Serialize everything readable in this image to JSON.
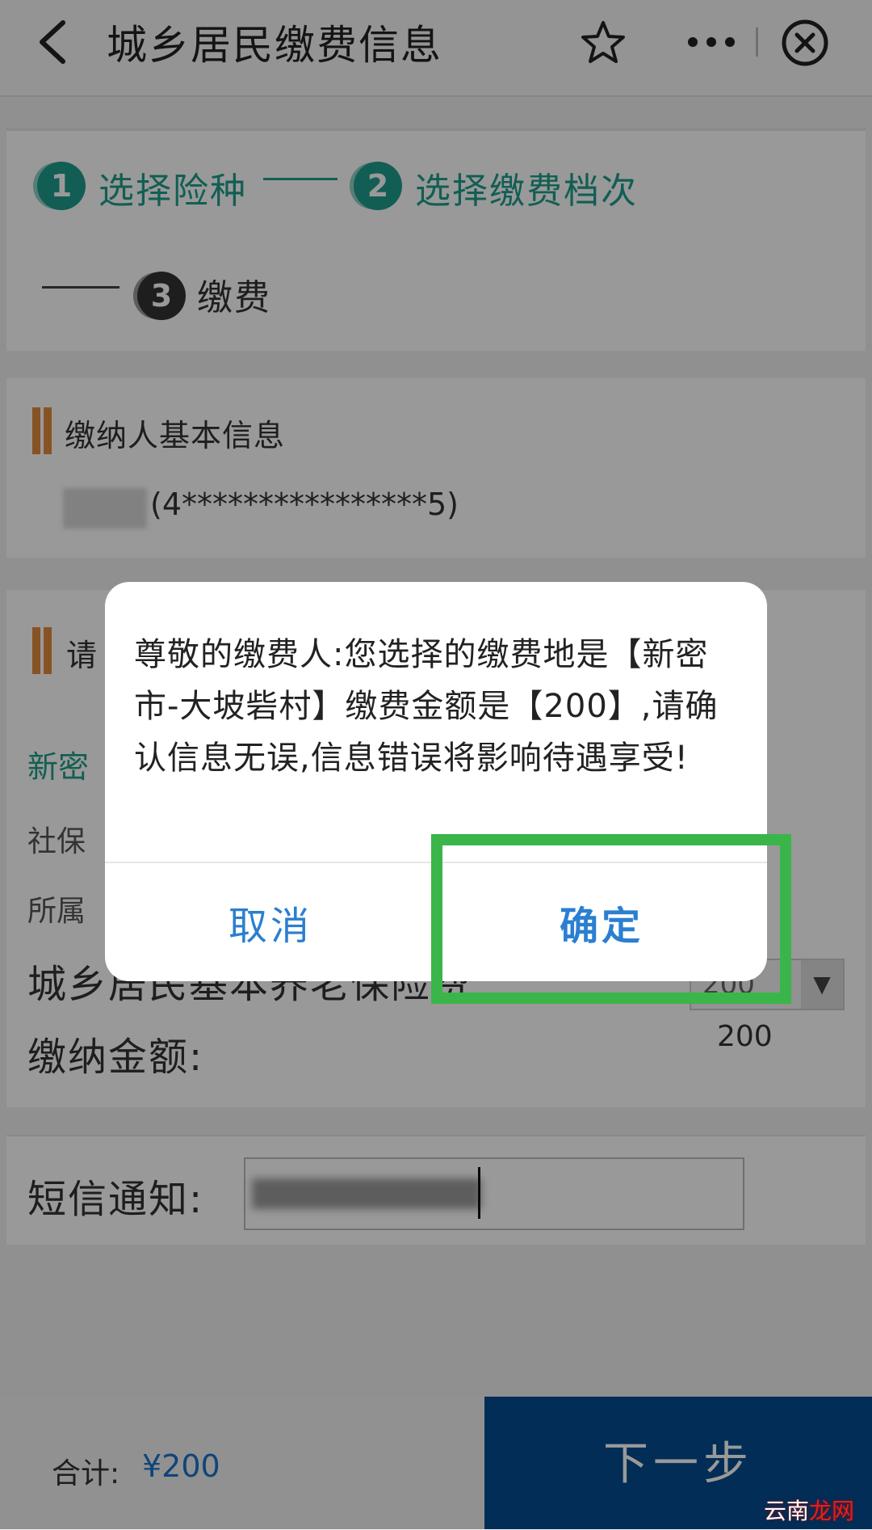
{
  "header": {
    "title": "城乡居民缴费信息",
    "icons": [
      "chevron-left-icon",
      "star-icon",
      "more-icon",
      "close-circle-icon"
    ]
  },
  "steps": [
    {
      "number": "1",
      "label": "选择险种",
      "state": "active"
    },
    {
      "number": "2",
      "label": "选择缴费档次",
      "state": "active"
    },
    {
      "number": "3",
      "label": "缴费",
      "state": "inactive"
    }
  ],
  "payer": {
    "section_title": "缴纳人基本信息",
    "id_masked": "(4****************5)"
  },
  "select_section": {
    "title_partial": "请",
    "location_partial": "新密",
    "social_label_partial": "社保",
    "belong_label_partial": "所属",
    "insurance_label": "城乡居民基本养老保险费",
    "tier_value": "200",
    "amount_label": "缴纳金额:",
    "amount_value": "200"
  },
  "sms": {
    "label": "短信通知:"
  },
  "bottom": {
    "total_label": "合计:",
    "total_value": "¥200",
    "next_label": "下一步"
  },
  "dialog": {
    "message": "尊敬的缴费人:您选择的缴费地是【新密市-大坡砦村】缴费金额是【200】,请确认信息无误,信息错误将影响待遇享受!",
    "cancel_label": "取消",
    "confirm_label": "确定"
  },
  "watermark": {
    "part1": "云南",
    "part2": "龙网"
  },
  "colors": {
    "accent_teal": "#1f9d8c",
    "link_blue": "#2a7fd0",
    "button_navy": "#034b8f",
    "highlight_green": "#3ab54a",
    "section_orange": "#e38b3c"
  }
}
